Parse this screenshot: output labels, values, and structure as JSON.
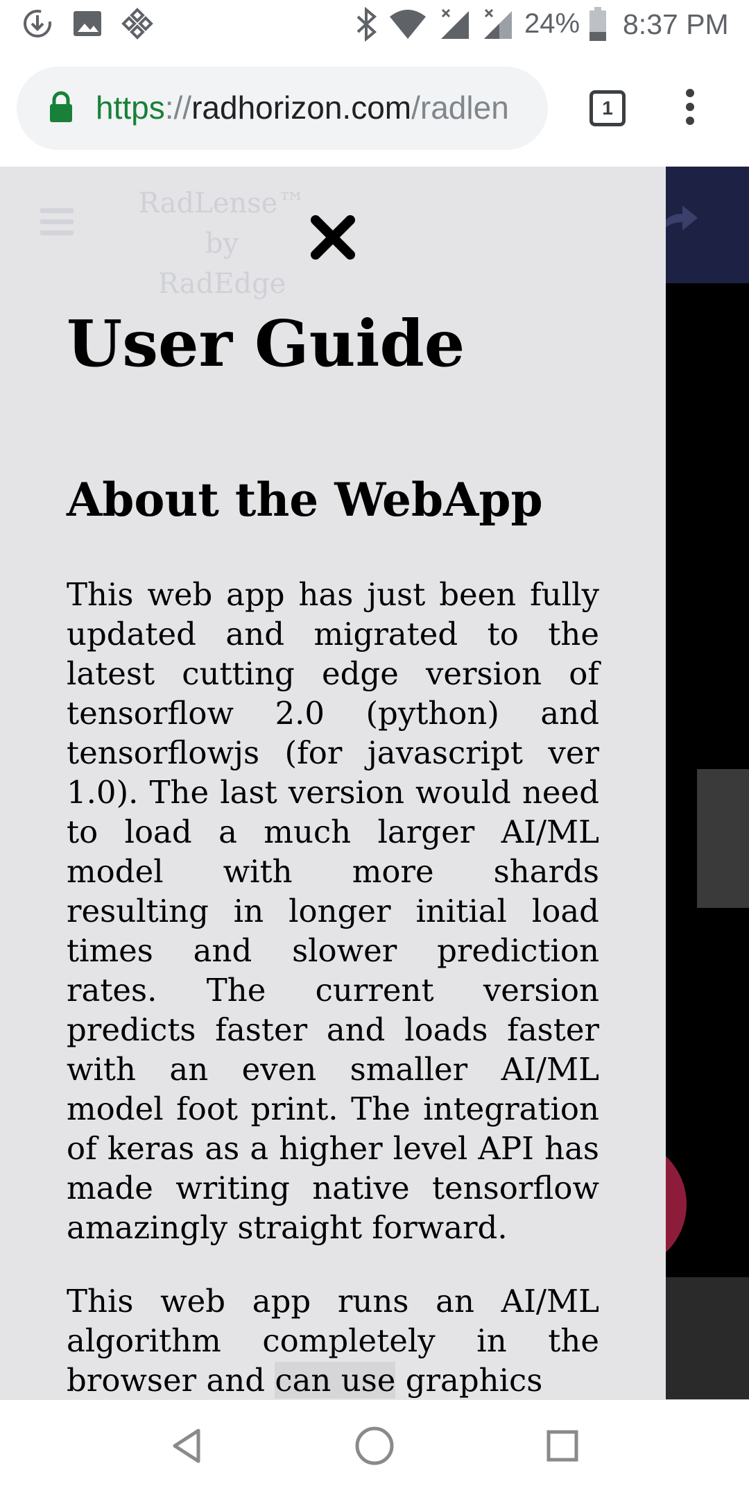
{
  "status_bar": {
    "battery_percent": "24%",
    "time": "8:37 PM",
    "icons": [
      "download-icon",
      "image-icon",
      "app-icon",
      "bluetooth-icon",
      "wifi-icon",
      "signal-icon",
      "signal-icon",
      "battery-icon"
    ]
  },
  "browser": {
    "url_scheme": "https",
    "url_separator": "://",
    "url_host": "radhorizon.com",
    "url_path": "/radlen",
    "tab_count": "1",
    "secure_color": "#188038"
  },
  "site": {
    "brand_line1": "RadLense™ by",
    "brand_line2": "RadEdge"
  },
  "guide": {
    "title": "User Guide",
    "section_title": "About the WebApp",
    "paragraph1": "This web app has just been fully updated and migrated to the latest cutting edge version of tensorflow 2.0 (python) and tensorflowjs (for javascript ver 1.0). The last version would need to load a much larger AI/ML model with more shards resulting in longer initial load times and slower prediction rates. The current version predicts faster and loads faster with an even smaller AI/ML model foot print. The integration of keras as a higher level API has made writing native tensorflow amazingly straight forward.",
    "paragraph2_start": "This web app runs an AI/ML algorithm completely in the browser and ",
    "paragraph2_highlight": "can use",
    "paragraph2_end": " graphics"
  },
  "colors": {
    "panel_bg": "#e4e4e6",
    "header_bg": "#1d2245",
    "accent_camera": "#8d1c3a"
  }
}
